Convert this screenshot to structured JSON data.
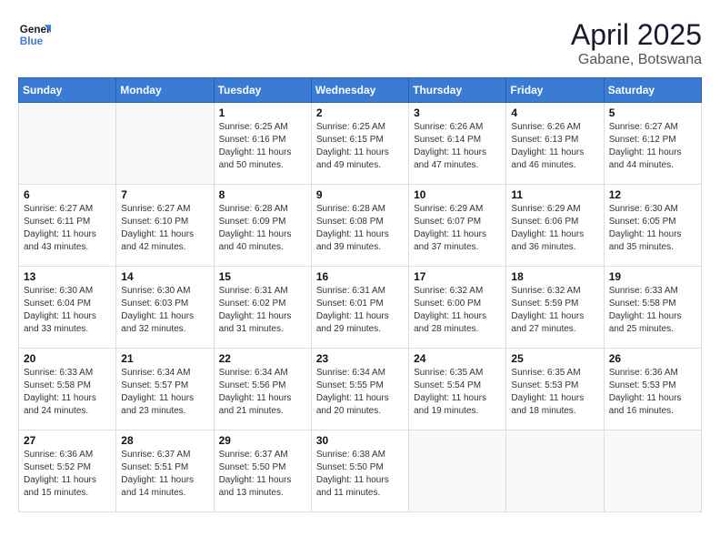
{
  "header": {
    "logo_line1": "General",
    "logo_line2": "Blue",
    "title": "April 2025",
    "subtitle": "Gabane, Botswana"
  },
  "weekdays": [
    "Sunday",
    "Monday",
    "Tuesday",
    "Wednesday",
    "Thursday",
    "Friday",
    "Saturday"
  ],
  "weeks": [
    [
      {
        "day": "",
        "info": ""
      },
      {
        "day": "",
        "info": ""
      },
      {
        "day": "1",
        "info": "Sunrise: 6:25 AM\nSunset: 6:16 PM\nDaylight: 11 hours and 50 minutes."
      },
      {
        "day": "2",
        "info": "Sunrise: 6:25 AM\nSunset: 6:15 PM\nDaylight: 11 hours and 49 minutes."
      },
      {
        "day": "3",
        "info": "Sunrise: 6:26 AM\nSunset: 6:14 PM\nDaylight: 11 hours and 47 minutes."
      },
      {
        "day": "4",
        "info": "Sunrise: 6:26 AM\nSunset: 6:13 PM\nDaylight: 11 hours and 46 minutes."
      },
      {
        "day": "5",
        "info": "Sunrise: 6:27 AM\nSunset: 6:12 PM\nDaylight: 11 hours and 44 minutes."
      }
    ],
    [
      {
        "day": "6",
        "info": "Sunrise: 6:27 AM\nSunset: 6:11 PM\nDaylight: 11 hours and 43 minutes."
      },
      {
        "day": "7",
        "info": "Sunrise: 6:27 AM\nSunset: 6:10 PM\nDaylight: 11 hours and 42 minutes."
      },
      {
        "day": "8",
        "info": "Sunrise: 6:28 AM\nSunset: 6:09 PM\nDaylight: 11 hours and 40 minutes."
      },
      {
        "day": "9",
        "info": "Sunrise: 6:28 AM\nSunset: 6:08 PM\nDaylight: 11 hours and 39 minutes."
      },
      {
        "day": "10",
        "info": "Sunrise: 6:29 AM\nSunset: 6:07 PM\nDaylight: 11 hours and 37 minutes."
      },
      {
        "day": "11",
        "info": "Sunrise: 6:29 AM\nSunset: 6:06 PM\nDaylight: 11 hours and 36 minutes."
      },
      {
        "day": "12",
        "info": "Sunrise: 6:30 AM\nSunset: 6:05 PM\nDaylight: 11 hours and 35 minutes."
      }
    ],
    [
      {
        "day": "13",
        "info": "Sunrise: 6:30 AM\nSunset: 6:04 PM\nDaylight: 11 hours and 33 minutes."
      },
      {
        "day": "14",
        "info": "Sunrise: 6:30 AM\nSunset: 6:03 PM\nDaylight: 11 hours and 32 minutes."
      },
      {
        "day": "15",
        "info": "Sunrise: 6:31 AM\nSunset: 6:02 PM\nDaylight: 11 hours and 31 minutes."
      },
      {
        "day": "16",
        "info": "Sunrise: 6:31 AM\nSunset: 6:01 PM\nDaylight: 11 hours and 29 minutes."
      },
      {
        "day": "17",
        "info": "Sunrise: 6:32 AM\nSunset: 6:00 PM\nDaylight: 11 hours and 28 minutes."
      },
      {
        "day": "18",
        "info": "Sunrise: 6:32 AM\nSunset: 5:59 PM\nDaylight: 11 hours and 27 minutes."
      },
      {
        "day": "19",
        "info": "Sunrise: 6:33 AM\nSunset: 5:58 PM\nDaylight: 11 hours and 25 minutes."
      }
    ],
    [
      {
        "day": "20",
        "info": "Sunrise: 6:33 AM\nSunset: 5:58 PM\nDaylight: 11 hours and 24 minutes."
      },
      {
        "day": "21",
        "info": "Sunrise: 6:34 AM\nSunset: 5:57 PM\nDaylight: 11 hours and 23 minutes."
      },
      {
        "day": "22",
        "info": "Sunrise: 6:34 AM\nSunset: 5:56 PM\nDaylight: 11 hours and 21 minutes."
      },
      {
        "day": "23",
        "info": "Sunrise: 6:34 AM\nSunset: 5:55 PM\nDaylight: 11 hours and 20 minutes."
      },
      {
        "day": "24",
        "info": "Sunrise: 6:35 AM\nSunset: 5:54 PM\nDaylight: 11 hours and 19 minutes."
      },
      {
        "day": "25",
        "info": "Sunrise: 6:35 AM\nSunset: 5:53 PM\nDaylight: 11 hours and 18 minutes."
      },
      {
        "day": "26",
        "info": "Sunrise: 6:36 AM\nSunset: 5:53 PM\nDaylight: 11 hours and 16 minutes."
      }
    ],
    [
      {
        "day": "27",
        "info": "Sunrise: 6:36 AM\nSunset: 5:52 PM\nDaylight: 11 hours and 15 minutes."
      },
      {
        "day": "28",
        "info": "Sunrise: 6:37 AM\nSunset: 5:51 PM\nDaylight: 11 hours and 14 minutes."
      },
      {
        "day": "29",
        "info": "Sunrise: 6:37 AM\nSunset: 5:50 PM\nDaylight: 11 hours and 13 minutes."
      },
      {
        "day": "30",
        "info": "Sunrise: 6:38 AM\nSunset: 5:50 PM\nDaylight: 11 hours and 11 minutes."
      },
      {
        "day": "",
        "info": ""
      },
      {
        "day": "",
        "info": ""
      },
      {
        "day": "",
        "info": ""
      }
    ]
  ]
}
